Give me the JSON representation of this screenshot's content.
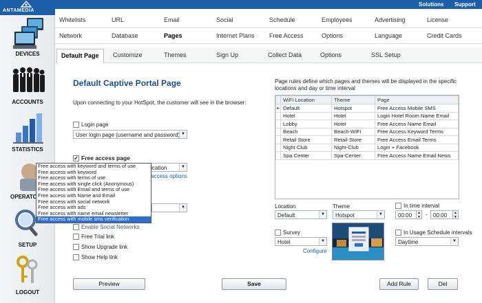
{
  "topbar": {
    "solutions": "Solutions",
    "support": "Support"
  },
  "sidebar": {
    "logo": "ANTAMEDIA",
    "items": [
      {
        "label": "DEVICES"
      },
      {
        "label": "ACCOUNTS"
      },
      {
        "label": "STATISTICS"
      },
      {
        "label": "OPERATORS"
      },
      {
        "label": "SETUP"
      },
      {
        "label": "LOGOUT"
      }
    ]
  },
  "tabs": {
    "row1": [
      "Whitelists",
      "URL",
      "Email",
      "Social",
      "Schedule",
      "Employees",
      "Advertising",
      "License"
    ],
    "row2": [
      "Network",
      "Database",
      "Pages",
      "Internet Plans",
      "Free Access",
      "Options",
      "Language",
      "Credit Cards"
    ],
    "row3": [
      "Default Page",
      "Customize",
      "Themes",
      "Sign Up",
      "Collect Data",
      "Options",
      "SSL Setup"
    ]
  },
  "main": {
    "title": "Default Captive Portal Page",
    "intro": "Upon connecting to your HotSpot, the customer will see in the browser:",
    "login_page_label": "Login page",
    "login_page_value": "User login page (username and password)",
    "free_access_label": "Free access page",
    "free_access_value_partial": "fication",
    "free_access_options_link": "access options",
    "enable_social_label": "Enable Social Networks",
    "free_trial_label": "Free Trial link",
    "upgrade_label": "Show Upgrade link",
    "help_label": "Show Help link"
  },
  "dropdown_options": [
    "Free access with keyword and terms of use",
    "Free access with keyword",
    "Free access with terms of use",
    "Free access with single click (Anonymous)",
    "Free access with Email and terms of use",
    "Free access with Name and Email",
    "Free access with social network",
    "Free access with ads",
    "Free access with name email newsletter",
    "Free access with mobile sms verification"
  ],
  "rules": {
    "description": "Page rules define which pages and themes will be displayed in the specific locations and day or time interval",
    "columns": [
      "WiFi Location",
      "Theme",
      "Page"
    ],
    "rows": [
      [
        "Default",
        "Hotspot",
        "Free Access Mobile SMS"
      ],
      [
        "Hotel",
        "Hotel",
        "Login Hotel Room Name Email"
      ],
      [
        "Lobby",
        "Hotel",
        "Free Access Name Email"
      ],
      [
        "Beach",
        "Beach-WiFi",
        "Free Access Keyword Terms"
      ],
      [
        "Retail Store",
        "Retail-Store",
        "Free Access Email Terms"
      ],
      [
        "Night Club",
        "Night-Club",
        "Login + Facebook"
      ],
      [
        "Spa Center",
        "Spa-Center",
        "Free Access Name Email News"
      ]
    ]
  },
  "filters": {
    "location_label": "Location",
    "location_value": "Default",
    "theme_label": "Theme",
    "theme_value": "Hotspot",
    "time_interval_label": "In time interval",
    "time_from": "00:00",
    "time_sep": "-",
    "time_to": "00:00",
    "survey_label": "Survey",
    "survey_value": "Hotel",
    "configure_link": "Configure",
    "usage_label": "In Usage Schedule intervals",
    "usage_value": "Daytime"
  },
  "buttons": {
    "preview": "Preview",
    "save": "Save",
    "add_rule": "Add Rule",
    "del": "Del"
  }
}
